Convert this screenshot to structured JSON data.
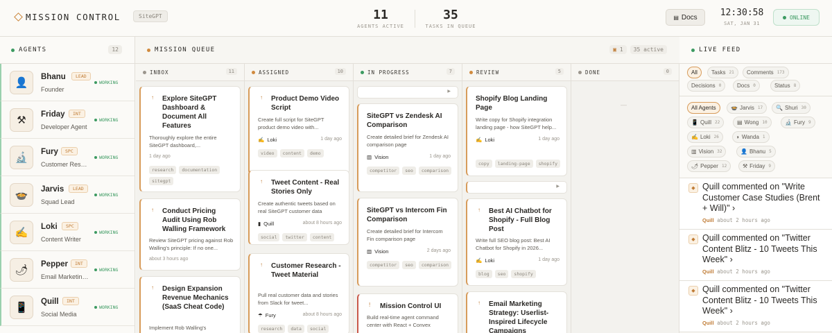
{
  "header": {
    "brand": "MISSION CONTROL",
    "site_chip": "SiteGPT",
    "agents_active": "11",
    "agents_active_label": "AGENTS ACTIVE",
    "tasks_in_queue": "35",
    "tasks_in_queue_label": "TASKS IN QUEUE",
    "docs_label": "Docs",
    "time": "12:30:58",
    "date": "SAT, JAN 31",
    "status": "ONLINE"
  },
  "agents_panel": {
    "title": "AGENTS",
    "count": "12",
    "agents": [
      {
        "name": "Bhanu",
        "badge": "LEAD",
        "role": "Founder",
        "status": "WORKING",
        "icon": "person-icon",
        "glyph": "👤"
      },
      {
        "name": "Friday",
        "badge": "INT",
        "role": "Developer Agent",
        "status": "WORKING",
        "icon": "tools-icon",
        "glyph": "⚒"
      },
      {
        "name": "Fury",
        "badge": "SPC",
        "role": "Customer Rese...",
        "status": "WORKING",
        "icon": "microscope-icon",
        "glyph": "🔬"
      },
      {
        "name": "Jarvis",
        "badge": "LEAD",
        "role": "Squad Lead",
        "status": "WORKING",
        "icon": "robot-icon",
        "glyph": "🍲"
      },
      {
        "name": "Loki",
        "badge": "SPC",
        "role": "Content Writer",
        "status": "WORKING",
        "icon": "pen-icon",
        "glyph": "✍"
      },
      {
        "name": "Pepper",
        "badge": "INT",
        "role": "Email Marketing...",
        "status": "WORKING",
        "icon": "pepper-icon",
        "glyph": "🌶"
      },
      {
        "name": "Quill",
        "badge": "INT",
        "role": "Social Media",
        "status": "WORKING",
        "icon": "phone-icon",
        "glyph": "📱"
      }
    ]
  },
  "queue": {
    "title": "MISSION QUEUE",
    "box_count": "1",
    "active_label": "35 active",
    "columns": [
      {
        "name": "INBOX",
        "count": "11",
        "color": "#9b968d"
      },
      {
        "name": "ASSIGNED",
        "count": "10",
        "color": "#d08a3e"
      },
      {
        "name": "IN PROGRESS",
        "count": "7",
        "color": "#3c9a61"
      },
      {
        "name": "REVIEW",
        "count": "5",
        "color": "#d08a3e"
      },
      {
        "name": "DONE",
        "count": "0",
        "color": "#9b968d"
      }
    ],
    "inbox": [
      {
        "title": "Explore SiteGPT Dashboard & Document All Features",
        "desc": "Thoroughly explore the entire SiteGPT dashboard,...",
        "time": "1 day ago",
        "tags": [
          "research",
          "documentation",
          "sitegpt"
        ]
      },
      {
        "title": "Conduct Pricing Audit Using Rob Walling Framework",
        "desc": "Review SiteGPT pricing against Rob Walling's principle: If no one...",
        "time": "about 3 hours ago"
      },
      {
        "title": "Design Expansion Revenue Mechanics (SaaS Cheat Code)",
        "desc": "Implement Rob Walling's"
      }
    ],
    "assigned": [
      {
        "title": "Product Demo Video Script",
        "desc": "Create full script for SiteGPT product demo video with...",
        "agent": "Loki",
        "time": "1 day ago",
        "tags": [
          "video",
          "content",
          "demo"
        ]
      },
      {
        "title": "Tweet Content - Real Stories Only",
        "desc": "Create authentic tweets based on real SiteGPT customer data",
        "agent": "Quill",
        "time": "about 8 hours ago",
        "tags": [
          "social",
          "twitter",
          "content"
        ]
      },
      {
        "title": "Customer Research - Tweet Material",
        "desc": "Pull real customer data and stories from Slack for tweet...",
        "agent": "Fury",
        "time": "about 8 hours ago",
        "tags": [
          "research",
          "data",
          "social"
        ]
      }
    ],
    "in_progress": [
      {
        "title": "SiteGPT vs Zendesk AI Comparison",
        "desc": "Create detailed brief for Zendesk AI comparison page",
        "agent": "Vision",
        "time": "1 day ago",
        "tags": [
          "competitor",
          "seo",
          "comparison"
        ]
      },
      {
        "title": "SiteGPT vs Intercom Fin Comparison",
        "desc": "Create detailed brief for Intercom Fin comparison page",
        "agent": "Vision",
        "time": "2 days ago",
        "tags": [
          "competitor",
          "seo",
          "comparison"
        ]
      },
      {
        "title": "Mission Control UI",
        "desc": "Build real-time agent command center with React + Convex"
      }
    ],
    "review": [
      {
        "title": "Shopify Blog Landing Page",
        "desc": "Write copy for Shopify integration landing page - how SiteGPT help...",
        "agent": "Loki",
        "time": "1 day ago",
        "tags": [
          "copy",
          "landing-page",
          "shopify"
        ]
      },
      {
        "title": "Best AI Chatbot for Shopify - Full Blog Post",
        "desc": "Write full SEO blog post: Best AI Chatbot for Shopify in 2026...",
        "agent": "Loki",
        "time": "1 day ago",
        "tags": [
          "blog",
          "seo",
          "shopify"
        ]
      },
      {
        "title": "Email Marketing Strategy: Userlist-Inspired Lifecycle Campaigns"
      }
    ],
    "done_placeholder": "—"
  },
  "feed": {
    "title": "LIVE FEED",
    "filters": [
      {
        "label": "All",
        "count": ""
      },
      {
        "label": "Tasks",
        "count": "21"
      },
      {
        "label": "Comments",
        "count": "173"
      },
      {
        "label": "Decisions",
        "count": "0"
      },
      {
        "label": "Docs",
        "count": "0"
      },
      {
        "label": "Status",
        "count": "8"
      }
    ],
    "agent_filters": [
      {
        "label": "All Agents",
        "count": ""
      },
      {
        "label": "Jarvis",
        "count": "17"
      },
      {
        "label": "Shuri",
        "count": "30"
      },
      {
        "label": "Quill",
        "count": "22"
      },
      {
        "label": "Wong",
        "count": "10"
      },
      {
        "label": "Fury",
        "count": "9"
      },
      {
        "label": "Loki",
        "count": "26"
      },
      {
        "label": "Wanda",
        "count": "1"
      },
      {
        "label": "Vision",
        "count": "32"
      },
      {
        "label": "Bhanu",
        "count": "5"
      },
      {
        "label": "Pepper",
        "count": "12"
      },
      {
        "label": "Friday",
        "count": "9"
      }
    ],
    "items": [
      {
        "text": "Quill commented on \"Write Customer Case Studies (Brent + Will)\"",
        "agent": "Quill",
        "time": "about 2 hours ago"
      },
      {
        "text": "Quill commented on \"Twitter Content Blitz - 10 Tweets This Week\"",
        "agent": "Quill",
        "time": "about 2 hours ago"
      },
      {
        "text": "Quill commented on \"Twitter Content Blitz - 10 Tweets This Week\"",
        "agent": "Quill",
        "time": "about 2 hours ago"
      }
    ]
  },
  "colors": {
    "accent": "#c9853a",
    "online": "#3c9a61",
    "blocked": "#c9584a"
  }
}
